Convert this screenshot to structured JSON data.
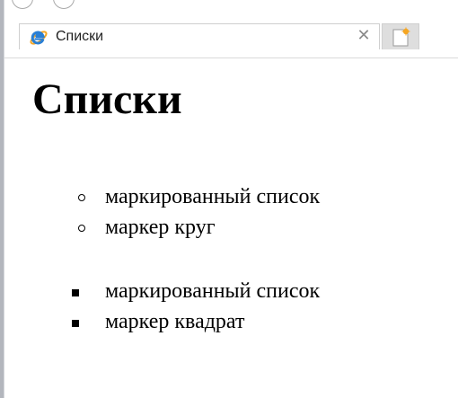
{
  "tab": {
    "title": "Списки",
    "close_icon": "close-icon",
    "favicon": "ie-logo-icon"
  },
  "new_tab": {
    "icon": "new-tab-icon"
  },
  "page": {
    "heading": "Списки",
    "circle_list": {
      "marker": "circle",
      "items": [
        "маркированный список",
        "маркер круг"
      ]
    },
    "square_list": {
      "marker": "square",
      "items": [
        "маркированный список",
        "маркер квадрат"
      ]
    }
  },
  "colors": {
    "text": "#000000",
    "ie_blue": "#2a7fd4",
    "ie_orange": "#f5a623",
    "new_tab_bg": "#dedede"
  }
}
